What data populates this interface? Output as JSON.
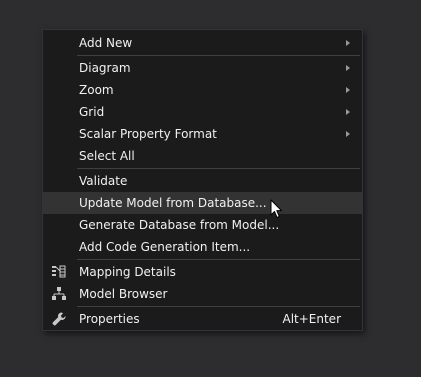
{
  "menu": {
    "add_new": "Add New",
    "diagram": "Diagram",
    "zoom": "Zoom",
    "grid": "Grid",
    "scalar_property_format": "Scalar Property Format",
    "select_all": "Select All",
    "validate": "Validate",
    "update_model": "Update Model from Database...",
    "generate_database": "Generate Database from Model...",
    "add_code_generation": "Add Code Generation Item...",
    "mapping_details": "Mapping Details",
    "model_browser": "Model Browser",
    "properties": "Properties",
    "properties_shortcut": "Alt+Enter"
  },
  "icons": {
    "mapping_details": "mapping-details-icon",
    "model_browser": "model-browser-icon",
    "properties": "wrench-icon",
    "submenu": "submenu-arrow-icon"
  },
  "colors": {
    "background": "#2d2d30",
    "menu_background": "#1b1b1c",
    "hover_background": "#333334",
    "text": "#f1f1f1",
    "separator": "#3f3f46"
  }
}
